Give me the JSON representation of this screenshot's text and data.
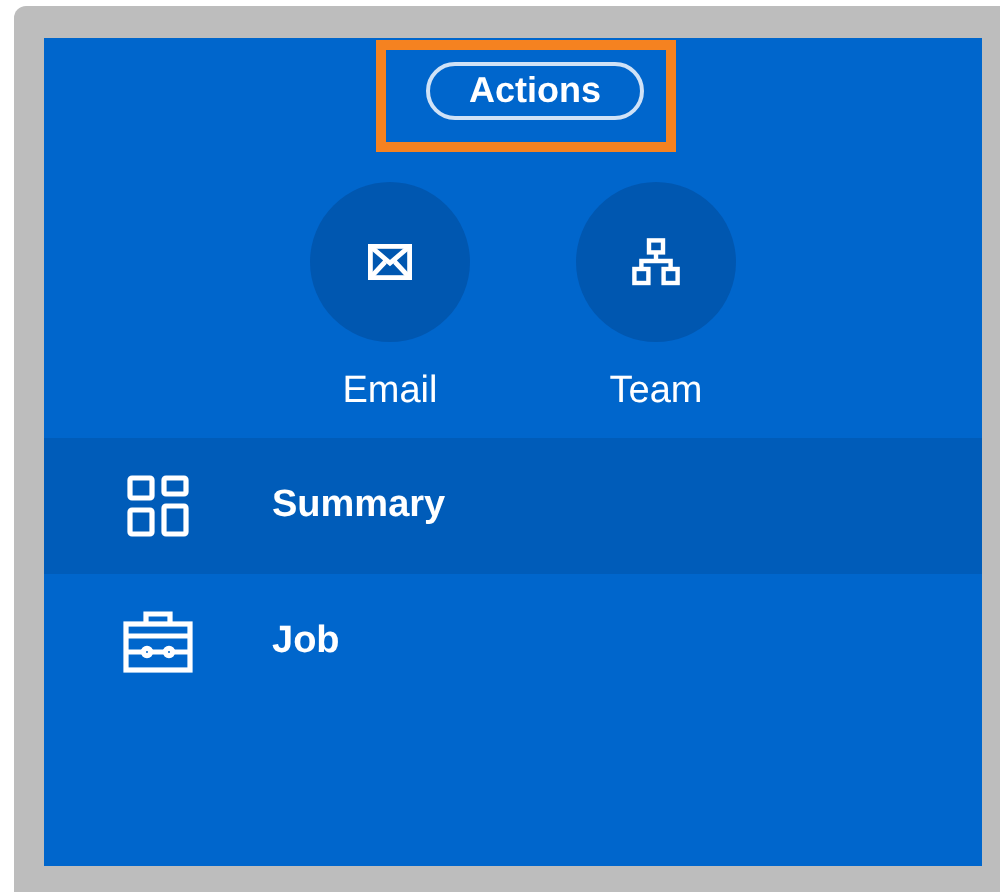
{
  "actions_button": {
    "label": "Actions",
    "highlighted": true
  },
  "quick_actions": [
    {
      "kind": "email",
      "label": "Email"
    },
    {
      "kind": "team",
      "label": "Team"
    }
  ],
  "nav_items": [
    {
      "kind": "summary",
      "label": "Summary",
      "selected": true
    },
    {
      "kind": "job",
      "label": "Job",
      "selected": false
    }
  ]
}
